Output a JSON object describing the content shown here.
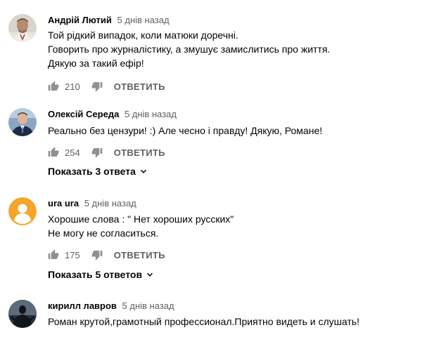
{
  "reply_label": "ОТВЕТИТЬ",
  "comments": [
    {
      "author": "Андрій Лютий",
      "time": "5 днів назад",
      "lines": [
        "Той рідкий випадок, коли матюки доречні.",
        "Говорить про журналістику, а змушує замислитись про життя.",
        "Дякую за такий ефір!"
      ],
      "likes": "210",
      "avatar_icon": "photo-avatar-man-in-embroidered-shirt"
    },
    {
      "author": "Олексій Середа",
      "time": "5 днів назад",
      "lines": [
        "Реально без цензури! :) Але чесно і правду! Дякую, Романе!"
      ],
      "likes": "254",
      "avatar_icon": "photo-avatar-man-in-suit",
      "replies_label": "Показать 3 ответа"
    },
    {
      "author": "ura ura",
      "time": "5 днів назад",
      "lines": [
        "Хорошие слова : \" Нет хороших русских\"",
        "Не могу не согласиться."
      ],
      "likes": "175",
      "avatar_icon": "default-user-avatar-icon",
      "replies_label": "Показать 5 ответов"
    },
    {
      "author": "кирилл лавров",
      "time": "5 днів назад",
      "lines": [
        "Роман крутой,грамотный профессионал.Приятно видеть и слушать!"
      ],
      "avatar_icon": "photo-avatar-dark-silhouette"
    }
  ],
  "colors": {
    "default_avatar_bg": "#f4a62a",
    "secondary_text": "#606060",
    "primary_text": "#030303"
  }
}
